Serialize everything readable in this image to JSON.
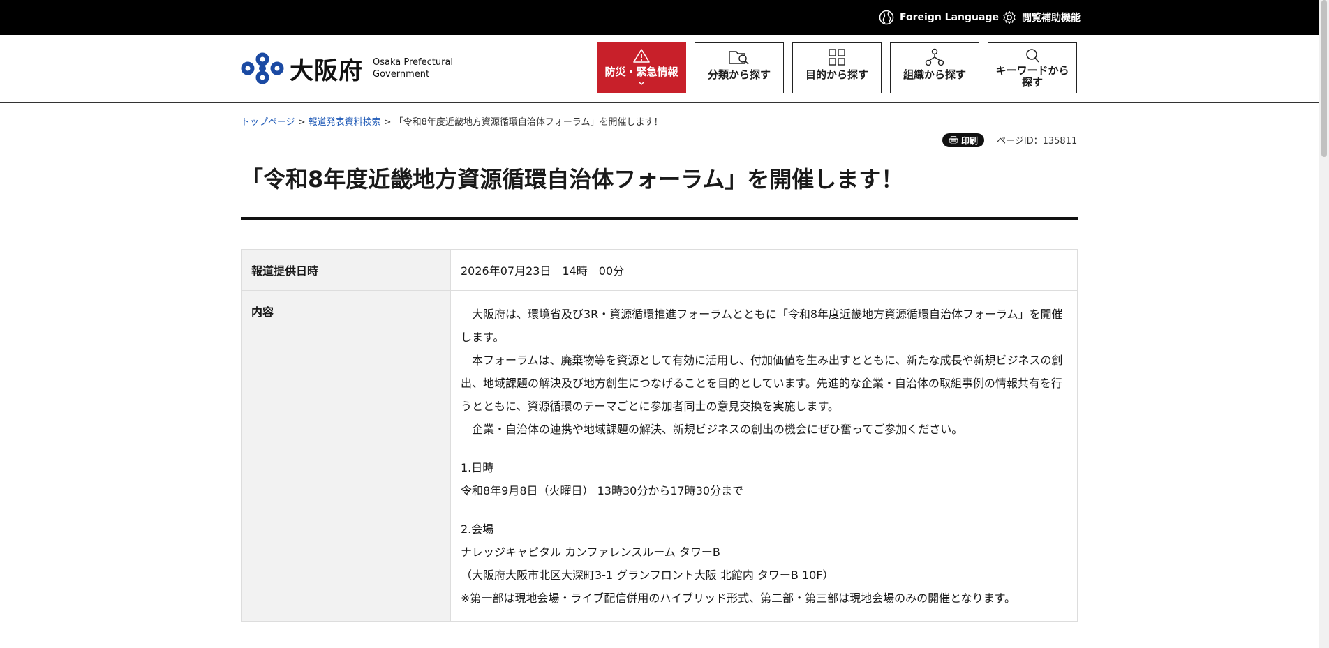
{
  "topbar": {
    "foreign_language": "Foreign Language",
    "accessibility": "閲覧補助機能"
  },
  "header": {
    "logo_ja": "大阪府",
    "logo_en": "Osaka Prefectural\nGovernment",
    "nav": [
      {
        "label": "防災・緊急情報",
        "icon": "warning-icon"
      },
      {
        "label": "分類から探す",
        "icon": "category-search-icon"
      },
      {
        "label": "目的から探す",
        "icon": "grid-icon"
      },
      {
        "label": "組織から探す",
        "icon": "organization-icon"
      },
      {
        "label": "キーワードから\n探す",
        "icon": "search-icon"
      }
    ]
  },
  "breadcrumb": {
    "home": "トップページ",
    "sep1": ">",
    "press": "報道発表資料検索",
    "sep2": ">",
    "current": "「令和8年度近畿地方資源循環自治体フォーラム」を開催します！"
  },
  "print_label": "印刷",
  "page_id": "ページID：135811",
  "title": "「令和8年度近畿地方資源循環自治体フォーラム」を開催します！",
  "info": {
    "date_label": "報道提供日時",
    "date_value": "2026年07月23日　14時　00分",
    "content_label": "内容",
    "content": {
      "p1": "大阪府は、環境省及び3R・資源循環推進フォーラムとともに「令和8年度近畿地方資源循環自治体フォーラム」を開催します。",
      "p2": "本フォーラムは、廃棄物等を資源として有効に活用し、付加価値を生み出すとともに、新たな成長や新規ビジネスの創出、地域課題の解決及び地方創生につなげることを目的としています。先進的な企業・自治体の取組事例の情報共有を行うとともに、資源循環のテーマごとに参加者同士の意見交換を実施します。",
      "p3": "企業・自治体の連携や地域課題の解決、新規ビジネスの創出の機会にぜひ奮ってご参加ください。",
      "s1_heading": "1.日時",
      "s1_text": "令和8年9月8日（火曜日） 13時30分から17時30分まで",
      "s2_heading": "2.会場",
      "s2_venue": "ナレッジキャピタル カンファレンスルーム タワーB",
      "s2_address": "（大阪府大阪市北区大深町3-1 グランフロント大阪 北館内 タワーB 10F）",
      "s2_note": "※第一部は現地会場・ライブ配信併用のハイブリッド形式、第二部・第三部は現地会場のみの開催となります。"
    }
  }
}
